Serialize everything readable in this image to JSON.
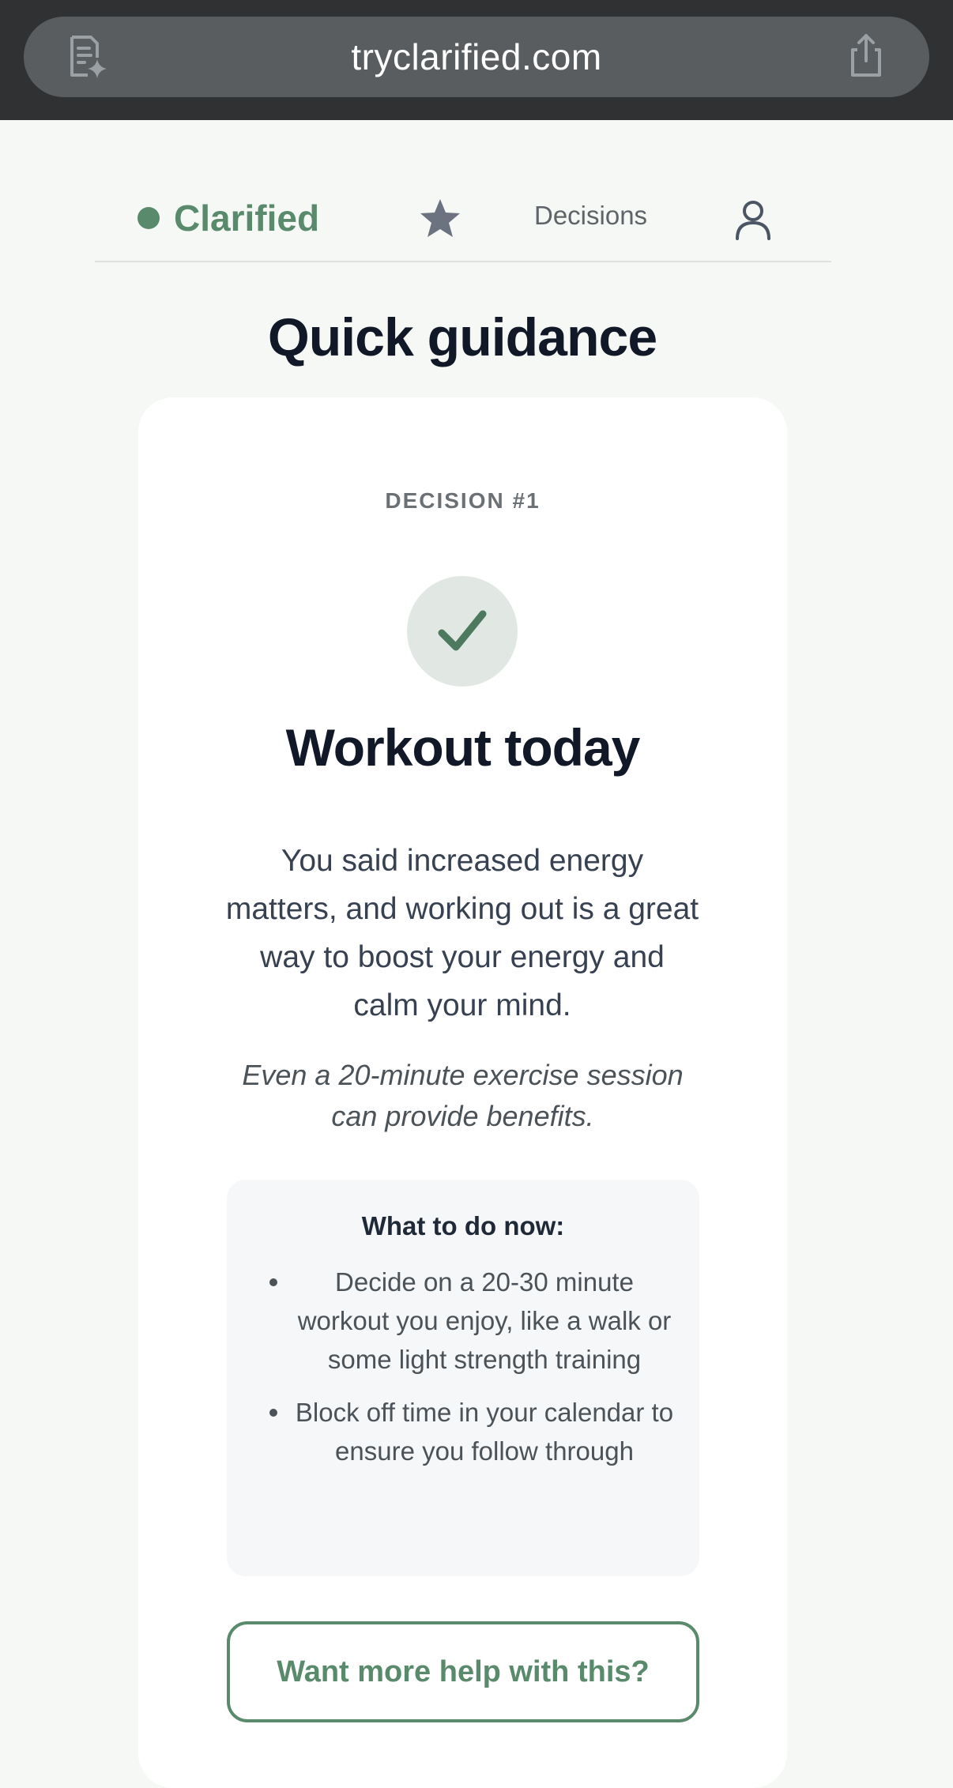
{
  "browser": {
    "url": "tryclarified.com",
    "left_icon": "reader-mode-icon",
    "right_icon": "share-icon"
  },
  "nav": {
    "brand_name": "Clarified",
    "decisions_label": "Decisions",
    "star_icon": "star-icon",
    "profile_icon": "user-icon"
  },
  "page": {
    "title": "Quick guidance"
  },
  "card": {
    "decision_label": "DECISION #1",
    "title": "Workout today",
    "body": "You said increased energy matters, and working out is a great way to boost your energy and calm your mind.",
    "note": "Even a 20-minute exercise session can provide benefits.",
    "todo": {
      "heading": "What to do now:",
      "items": [
        "Decide on a 20-30 minute workout you enjoy, like a walk or some light strength training",
        "Block off time in your calendar to ensure you follow through"
      ]
    },
    "help_button_label": "Want more help with this?"
  },
  "colors": {
    "brand_green": "#5a8a6c",
    "page_background": "#f6f8f6",
    "card_background": "#ffffff",
    "check_circle_bg": "#e1e8e3",
    "browser_bar": "#2f3133"
  }
}
